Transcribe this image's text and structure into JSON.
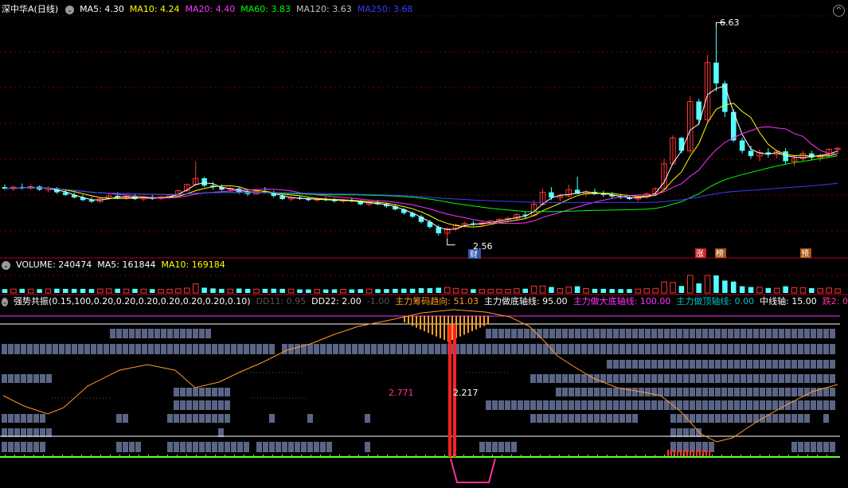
{
  "colors": {
    "up": "#ff3232",
    "down": "#54ffff",
    "ma5": "#ffffff",
    "ma10": "#ffff00",
    "ma20": "#ff33ff",
    "ma60": "#00ff00",
    "ma120": "#c0c0c0",
    "ma250": "#3b3bff",
    "sep": "#b00020",
    "grid": "#7a0000",
    "block": "#5a6586",
    "orange": "#ff9a2a",
    "hist": "#ffa020",
    "pink": "#ff3399",
    "green": "#66ff33",
    "cyan": "#00c0c0"
  },
  "main": {
    "title": "深中华A(日线)",
    "ma": [
      {
        "label": "MA5: 4.30",
        "color": "#ffffff"
      },
      {
        "label": "MA10: 4.24",
        "color": "#ffff00"
      },
      {
        "label": "MA20: 4.40",
        "color": "#ff33ff"
      },
      {
        "label": "MA60: 3.83",
        "color": "#00ff00"
      },
      {
        "label": "MA120: 3.63",
        "color": "#c0c0c0"
      },
      {
        "label": "MA250: 3.68",
        "color": "#3b3bff"
      }
    ]
  },
  "volume": {
    "labels": [
      {
        "label": "VOLUME: 240474",
        "color": "#ffffff"
      },
      {
        "label": "MA5: 161844",
        "color": "#ffffff"
      },
      {
        "label": "MA10: 169184",
        "color": "#ffff00"
      }
    ]
  },
  "indicator": {
    "title": "强势共振(0.15,100,0.20,0.20,0.20,0.20,0.20,0.20,0.10)",
    "items": [
      {
        "label": "DD11: 0.95",
        "color": "#555555"
      },
      {
        "label": "DD22: 2.00",
        "color": "#ffffff"
      },
      {
        "label": "-1.00",
        "color": "#555555"
      },
      {
        "label": "主力筹码趋向: 51.03",
        "color": "#ffa020"
      },
      {
        "label": "主力做底轴线: 95.00",
        "color": "#ffffff"
      },
      {
        "label": "主力做大底轴线: 100.00",
        "color": "#ff33ff"
      },
      {
        "label": "主力做顶轴线: 0.00",
        "color": "#00c0c0"
      },
      {
        "label": "中线轴: 15.00",
        "color": "#ffffff"
      },
      {
        "label": "跌2: 0",
        "color": "#ff3399"
      }
    ]
  },
  "annotations": {
    "high": "6.63",
    "low": "2.56",
    "low_tag": "财",
    "tags": [
      "涨",
      "榜",
      "预"
    ],
    "val_left": "2.771",
    "val_right": "2.217"
  },
  "chart_data": {
    "type": "candlestick",
    "price_range": [
      2.4,
      6.85
    ],
    "highest": 6.63,
    "lowest": 2.56,
    "ohlc": [
      [
        3.55,
        3.6,
        3.5,
        3.52
      ],
      [
        3.52,
        3.58,
        3.48,
        3.55
      ],
      [
        3.55,
        3.62,
        3.5,
        3.53
      ],
      [
        3.53,
        3.6,
        3.5,
        3.56
      ],
      [
        3.56,
        3.58,
        3.48,
        3.5
      ],
      [
        3.5,
        3.56,
        3.45,
        3.53
      ],
      [
        3.53,
        3.55,
        3.42,
        3.45
      ],
      [
        3.45,
        3.5,
        3.38,
        3.4
      ],
      [
        3.4,
        3.45,
        3.33,
        3.35
      ],
      [
        3.35,
        3.4,
        3.28,
        3.3
      ],
      [
        3.3,
        3.36,
        3.25,
        3.27
      ],
      [
        3.27,
        3.35,
        3.24,
        3.33
      ],
      [
        3.33,
        3.42,
        3.3,
        3.38
      ],
      [
        3.38,
        3.45,
        3.32,
        3.35
      ],
      [
        3.35,
        3.4,
        3.3,
        3.37
      ],
      [
        3.37,
        3.42,
        3.3,
        3.32
      ],
      [
        3.32,
        3.38,
        3.28,
        3.35
      ],
      [
        3.35,
        3.4,
        3.3,
        3.33
      ],
      [
        3.33,
        3.38,
        3.3,
        3.36
      ],
      [
        3.36,
        3.42,
        3.33,
        3.4
      ],
      [
        3.4,
        3.5,
        3.38,
        3.48
      ],
      [
        3.48,
        3.62,
        3.45,
        3.6
      ],
      [
        3.6,
        4.05,
        3.58,
        3.72
      ],
      [
        3.72,
        3.75,
        3.55,
        3.58
      ],
      [
        3.58,
        3.65,
        3.5,
        3.55
      ],
      [
        3.55,
        3.6,
        3.48,
        3.5
      ],
      [
        3.5,
        3.55,
        3.45,
        3.52
      ],
      [
        3.52,
        3.56,
        3.42,
        3.45
      ],
      [
        3.45,
        3.5,
        3.38,
        3.42
      ],
      [
        3.42,
        3.5,
        3.4,
        3.47
      ],
      [
        3.47,
        3.55,
        3.43,
        3.45
      ],
      [
        3.45,
        3.48,
        3.35,
        3.38
      ],
      [
        3.38,
        3.42,
        3.3,
        3.32
      ],
      [
        3.32,
        3.38,
        3.28,
        3.35
      ],
      [
        3.35,
        3.38,
        3.3,
        3.33
      ],
      [
        3.33,
        3.36,
        3.28,
        3.3
      ],
      [
        3.3,
        3.35,
        3.27,
        3.32
      ],
      [
        3.32,
        3.36,
        3.28,
        3.3
      ],
      [
        3.3,
        3.34,
        3.25,
        3.28
      ],
      [
        3.28,
        3.32,
        3.24,
        3.3
      ],
      [
        3.3,
        3.34,
        3.26,
        3.28
      ],
      [
        3.28,
        3.3,
        3.2,
        3.22
      ],
      [
        3.22,
        3.28,
        3.18,
        3.25
      ],
      [
        3.25,
        3.3,
        3.2,
        3.22
      ],
      [
        3.22,
        3.25,
        3.15,
        3.18
      ],
      [
        3.18,
        3.22,
        3.1,
        3.12
      ],
      [
        3.12,
        3.15,
        3.02,
        3.05
      ],
      [
        3.05,
        3.08,
        2.95,
        2.98
      ],
      [
        2.98,
        3.02,
        2.85,
        2.88
      ],
      [
        2.88,
        2.92,
        2.75,
        2.78
      ],
      [
        2.78,
        2.82,
        2.62,
        2.66
      ],
      [
        2.66,
        2.78,
        2.56,
        2.75
      ],
      [
        2.75,
        2.85,
        2.7,
        2.82
      ],
      [
        2.82,
        2.88,
        2.78,
        2.85
      ],
      [
        2.85,
        2.9,
        2.8,
        2.83
      ],
      [
        2.83,
        2.88,
        2.8,
        2.86
      ],
      [
        2.86,
        2.92,
        2.83,
        2.9
      ],
      [
        2.9,
        2.95,
        2.86,
        2.93
      ],
      [
        2.93,
        2.98,
        2.9,
        2.95
      ],
      [
        2.95,
        3.05,
        2.92,
        3.02
      ],
      [
        3.02,
        3.08,
        2.95,
        3.0
      ],
      [
        3.0,
        3.3,
        2.98,
        3.22
      ],
      [
        3.22,
        3.52,
        3.2,
        3.45
      ],
      [
        3.45,
        3.55,
        3.3,
        3.35
      ],
      [
        3.35,
        3.42,
        3.28,
        3.38
      ],
      [
        3.38,
        3.6,
        3.35,
        3.5
      ],
      [
        3.5,
        3.75,
        3.45,
        3.42
      ],
      [
        3.42,
        3.5,
        3.36,
        3.46
      ],
      [
        3.46,
        3.52,
        3.4,
        3.43
      ],
      [
        3.43,
        3.48,
        3.36,
        3.4
      ],
      [
        3.4,
        3.45,
        3.34,
        3.37
      ],
      [
        3.37,
        3.42,
        3.32,
        3.35
      ],
      [
        3.35,
        3.4,
        3.3,
        3.32
      ],
      [
        3.32,
        3.38,
        3.28,
        3.36
      ],
      [
        3.36,
        3.45,
        3.32,
        3.42
      ],
      [
        3.42,
        3.55,
        3.4,
        3.52
      ],
      [
        3.52,
        4.1,
        3.5,
        4.0
      ],
      [
        4.0,
        4.55,
        3.98,
        4.5
      ],
      [
        4.5,
        4.52,
        4.2,
        4.25
      ],
      [
        4.25,
        5.3,
        4.2,
        5.2
      ],
      [
        5.2,
        5.25,
        4.75,
        4.85
      ],
      [
        4.85,
        6.1,
        4.8,
        5.95
      ],
      [
        5.95,
        6.63,
        5.4,
        5.55
      ],
      [
        5.55,
        5.6,
        4.9,
        5.0
      ],
      [
        5.0,
        5.05,
        4.42,
        4.45
      ],
      [
        4.45,
        4.5,
        4.2,
        4.25
      ],
      [
        4.25,
        4.35,
        4.1,
        4.15
      ],
      [
        4.15,
        4.28,
        4.05,
        4.22
      ],
      [
        4.22,
        4.3,
        4.12,
        4.18
      ],
      [
        4.18,
        4.26,
        4.1,
        4.24
      ],
      [
        4.24,
        4.3,
        4.0,
        4.05
      ],
      [
        4.05,
        4.15,
        3.95,
        4.1
      ],
      [
        4.1,
        4.25,
        4.05,
        4.2
      ],
      [
        4.2,
        4.25,
        4.08,
        4.12
      ],
      [
        4.12,
        4.2,
        4.05,
        4.16
      ],
      [
        4.16,
        4.3,
        4.12,
        4.28
      ],
      [
        4.28,
        4.32,
        4.2,
        4.3
      ]
    ]
  }
}
